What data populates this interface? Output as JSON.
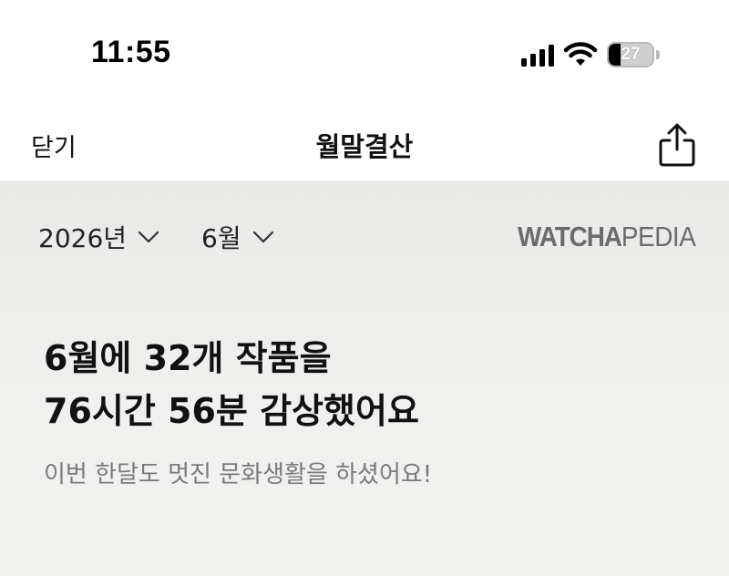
{
  "status_bar": {
    "time": "11:55",
    "battery_level": "27",
    "battery_fraction": 0.27,
    "icons": [
      "cellular-signal-icon",
      "wifi-icon",
      "battery-icon"
    ]
  },
  "nav": {
    "close_label": "닫기",
    "title": "월말결산",
    "share_icon": "share-icon"
  },
  "filters": {
    "year_label": "2026년",
    "month_label": "6월",
    "chevron_icon": "chevron-down-icon"
  },
  "brand": {
    "part1": "WATCHA",
    "part2": "PEDIA"
  },
  "summary": {
    "headline_line1": "6월에 32개 작품을",
    "headline_line2": "76시간 56분 감상했어요",
    "subtitle": "이번 한달도 멋진 문화생활을 하셨어요!"
  },
  "colors": {
    "content_bg": "#ededeb",
    "brand_gray": "#6b6b6b",
    "subtitle_gray": "#7a7a7a"
  }
}
